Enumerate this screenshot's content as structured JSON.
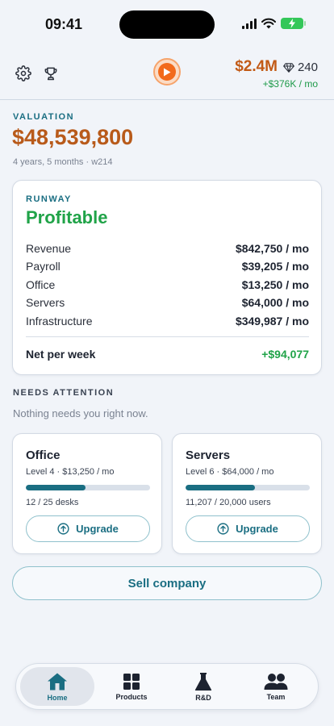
{
  "status_bar": {
    "time": "09:41"
  },
  "toolbar": {
    "cash": "$2.4M",
    "gems": "240",
    "income": "+$376K / mo"
  },
  "valuation": {
    "label": "VALUATION",
    "amount": "$48,539,800",
    "subtitle": "4 years, 5 months · w214"
  },
  "runway": {
    "label": "RUNWAY",
    "status": "Profitable",
    "rows": [
      {
        "label": "Revenue",
        "amount": "$842,750 / mo"
      },
      {
        "label": "Payroll",
        "amount": "$39,205 / mo"
      },
      {
        "label": "Office",
        "amount": "$13,250 / mo"
      },
      {
        "label": "Servers",
        "amount": "$64,000 / mo"
      },
      {
        "label": "Infrastructure",
        "amount": "$349,987 / mo"
      }
    ],
    "net_label": "Net per week",
    "net_amount": "+$94,077"
  },
  "attention": {
    "label": "NEEDS ATTENTION",
    "message": "Nothing needs you right now."
  },
  "office": {
    "title": "Office",
    "level": "Level 4 · $13,250 / mo",
    "progress": 0.48,
    "capacity": "12 / 25 desks",
    "upgrade_label": "Upgrade"
  },
  "servers": {
    "title": "Servers",
    "level": "Level 6 · $64,000 / mo",
    "progress": 0.56,
    "capacity": "11,207 / 20,000 users",
    "upgrade_label": "Upgrade"
  },
  "sell_label": "Sell company",
  "nav": {
    "home": "Home",
    "products": "Products",
    "rd": "R&D",
    "team": "Team"
  },
  "colors": {
    "accent": "#1a6e82",
    "cash": "#c25a16",
    "positive": "#20a348",
    "play": "#f26a1b"
  }
}
